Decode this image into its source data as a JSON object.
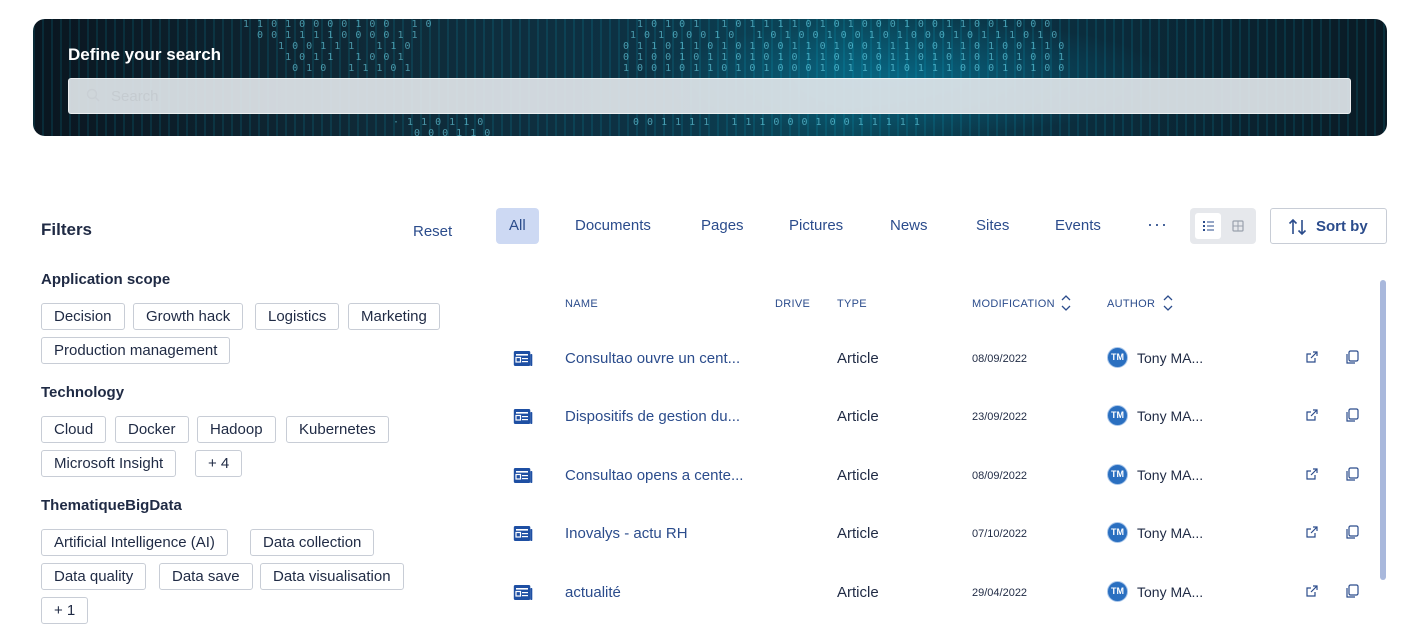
{
  "hero": {
    "title": "Define your search",
    "search_placeholder": "Search"
  },
  "filters": {
    "title": "Filters",
    "reset_label": "Reset",
    "groups": [
      {
        "title": "Application scope",
        "chips": [
          "Decision",
          "Growth hack",
          "Logistics",
          "Marketing",
          "Production management"
        ]
      },
      {
        "title": "Technology",
        "chips": [
          "Cloud",
          "Docker",
          "Hadoop",
          "Kubernetes",
          "Microsoft Insight",
          "+ 4"
        ]
      },
      {
        "title": "ThematiqueBigData",
        "chips": [
          "Artificial Intelligence (AI)",
          "Data collection",
          "Data quality",
          "Data save",
          "Data visualisation",
          "+ 1"
        ]
      }
    ]
  },
  "tabs": [
    "All",
    "Documents",
    "Pages",
    "Pictures",
    "News",
    "Sites",
    "Events"
  ],
  "more_label": "···",
  "sort_label": "Sort by",
  "table": {
    "headers": {
      "name": "NAME",
      "drive": "DRIVE",
      "type": "TYPE",
      "modification": "MODIFICATION",
      "author": "AUTHOR"
    },
    "rows": [
      {
        "name": "Consultao ouvre un cent...",
        "type": "Article",
        "date": "08/09/2022",
        "initials": "TM",
        "author": "Tony MA..."
      },
      {
        "name": "Dispositifs de gestion du...",
        "type": "Article",
        "date": "23/09/2022",
        "initials": "TM",
        "author": "Tony MA..."
      },
      {
        "name": "Consultao opens a cente...",
        "type": "Article",
        "date": "08/09/2022",
        "initials": "TM",
        "author": "Tony MA..."
      },
      {
        "name": "Inovalys - actu RH",
        "type": "Article",
        "date": "07/10/2022",
        "initials": "TM",
        "author": "Tony MA..."
      },
      {
        "name": "actualité",
        "type": "Article",
        "date": "29/04/2022",
        "initials": "TM",
        "author": "Tony MA..."
      }
    ]
  },
  "colors": {
    "accent": "#2b4c8c",
    "active_tab_bg": "#cdd9f3",
    "avatar": "#2a6fc0"
  },
  "icons": {
    "search": "search-icon",
    "doc": "news-article-icon",
    "share": "share-icon",
    "copy": "copy-icon",
    "sort": "sort-icon"
  }
}
